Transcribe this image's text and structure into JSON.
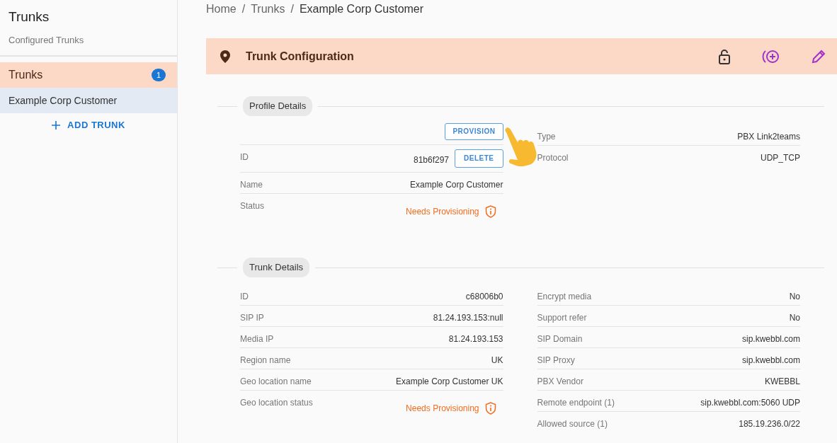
{
  "sidebar": {
    "title": "Trunks",
    "subtitle": "Configured Trunks",
    "group": {
      "label": "Trunks",
      "badge": "1"
    },
    "trunks": [
      {
        "label": "Example Corp Customer",
        "selected": true
      }
    ],
    "add_button": "ADD TRUNK"
  },
  "breadcrumb": {
    "separator": "/",
    "items": [
      "Home",
      "Trunks",
      "Example Corp Customer"
    ]
  },
  "panel": {
    "title": "Trunk Configuration"
  },
  "sections": [
    {
      "title": "Profile Details",
      "left": [
        {
          "kind": "action",
          "button": "PROVISION"
        },
        {
          "kind": "plain",
          "label": "ID",
          "value": "81b6f297",
          "button": "DELETE"
        },
        {
          "kind": "plain",
          "label": "Name",
          "value": "Example Corp Customer"
        },
        {
          "kind": "warning",
          "label": "Status",
          "value": "Needs Provisioning"
        }
      ],
      "right": [
        {
          "kind": "plain",
          "label": "Type",
          "value": "PBX Link2teams"
        },
        {
          "kind": "plain",
          "label": "Protocol",
          "value": "UDP_TCP"
        }
      ]
    },
    {
      "title": "Trunk Details",
      "left": [
        {
          "kind": "plain",
          "label": "ID",
          "value": "c68006b0"
        },
        {
          "kind": "plain",
          "label": "SIP IP",
          "value": "81.24.193.153:null"
        },
        {
          "kind": "plain",
          "label": "Media IP",
          "value": "81.24.193.153"
        },
        {
          "kind": "plain",
          "label": "Region name",
          "value": "UK"
        },
        {
          "kind": "plain",
          "label": "Geo location name",
          "value": "Example Corp Customer UK"
        },
        {
          "kind": "warning",
          "label": "Geo location status",
          "value": "Needs Provisioning"
        }
      ],
      "right": [
        {
          "kind": "plain",
          "label": "Encrypt media",
          "value": "No"
        },
        {
          "kind": "plain",
          "label": "Support refer",
          "value": "No"
        },
        {
          "kind": "plain",
          "label": "SIP Domain",
          "value": "sip.kwebbl.com"
        },
        {
          "kind": "plain",
          "label": "SIP Proxy",
          "value": "sip.kwebbl.com"
        },
        {
          "kind": "plain",
          "label": "PBX Vendor",
          "value": "KWEBBL"
        },
        {
          "kind": "plain",
          "label": "Remote endpoint (1)",
          "value": "sip.kwebbl.com:5060 UDP"
        },
        {
          "kind": "plain",
          "label": "Allowed source (1)",
          "value": "185.19.236.0/22"
        }
      ]
    }
  ]
}
